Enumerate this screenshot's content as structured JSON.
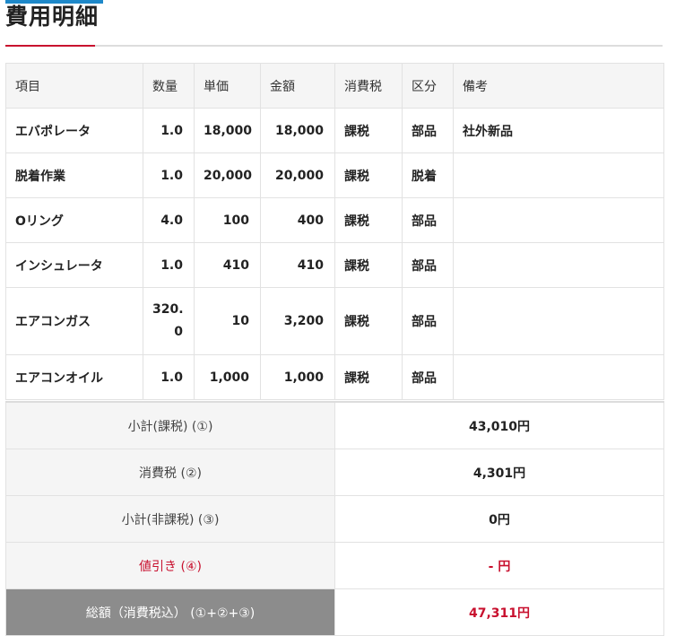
{
  "page": {
    "title": "費用明細"
  },
  "table": {
    "headers": {
      "item": "項目",
      "qty": "数量",
      "unit_price": "単価",
      "amount": "金額",
      "tax": "消費税",
      "category": "区分",
      "note": "備考"
    },
    "rows": [
      {
        "item": "エバポレータ",
        "qty": "1.0",
        "unit_price": "18,000",
        "amount": "18,000",
        "tax": "課税",
        "category": "部品",
        "note": "社外新品"
      },
      {
        "item": "脱着作業",
        "qty": "1.0",
        "unit_price": "20,000",
        "amount": "20,000",
        "tax": "課税",
        "category": "脱着",
        "note": ""
      },
      {
        "item": "Oリング",
        "qty": "4.0",
        "unit_price": "100",
        "amount": "400",
        "tax": "課税",
        "category": "部品",
        "note": ""
      },
      {
        "item": "インシュレータ",
        "qty": "1.0",
        "unit_price": "410",
        "amount": "410",
        "tax": "課税",
        "category": "部品",
        "note": ""
      },
      {
        "item": "エアコンガス",
        "qty_line1": "320.",
        "qty_line2": "0",
        "unit_price": "10",
        "amount": "3,200",
        "tax": "課税",
        "category": "部品",
        "note": ""
      },
      {
        "item": "エアコンオイル",
        "qty": "1.0",
        "unit_price": "1,000",
        "amount": "1,000",
        "tax": "課税",
        "category": "部品",
        "note": ""
      }
    ]
  },
  "summary": {
    "subtotal_taxable": {
      "label": "小計(課税) (①)",
      "value": "43,010円"
    },
    "consumption_tax": {
      "label": "消費税 (②)",
      "value": "4,301円"
    },
    "subtotal_nontaxable": {
      "label": "小計(非課税) (③)",
      "value": "0円"
    },
    "discount": {
      "label": "値引き (④)",
      "value": "- 円"
    },
    "total": {
      "label": "総額（消費税込） (①+②+③)",
      "value": "47,311円"
    }
  },
  "colors": {
    "accent_blue": "#1e88c9",
    "accent_red": "#c8102e",
    "total_label_bg": "#8c8c8c"
  }
}
